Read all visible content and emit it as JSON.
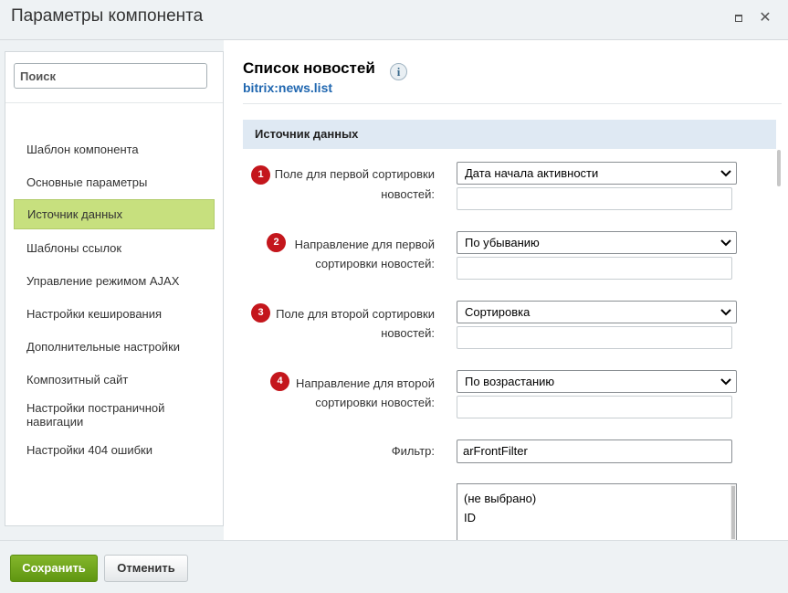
{
  "dialog": {
    "title": "Параметры компонента"
  },
  "sidebar": {
    "search_placeholder": "Поиск",
    "items": [
      {
        "label": "Шаблон компонента"
      },
      {
        "label": "Основные параметры"
      },
      {
        "label": "Источник данных",
        "active": true
      },
      {
        "label": "Шаблоны ссылок"
      },
      {
        "label": "Управление режимом AJAX"
      },
      {
        "label": "Настройки кеширования"
      },
      {
        "label": "Дополнительные настройки"
      },
      {
        "label": "Композитный сайт"
      },
      {
        "label": "Настройки постраничной навигации"
      },
      {
        "label": "Настройки 404 ошибки"
      }
    ]
  },
  "component": {
    "title": "Список новостей",
    "info_icon_glyph": "i",
    "code": "bitrix:news.list"
  },
  "section": {
    "title": "Источник данных"
  },
  "fields": [
    {
      "badge": "1",
      "label_line1": "Поле для первой сортировки",
      "label_line2": "новостей:",
      "value": "Дата начала активности",
      "extra_value": ""
    },
    {
      "badge": "2",
      "label_line1": "Направление для первой",
      "label_line2": "сортировки новостей:",
      "value": "По убыванию",
      "extra_value": ""
    },
    {
      "badge": "3",
      "label_line1": "Поле для второй сортировки",
      "label_line2": "новостей:",
      "value": "Сортировка",
      "extra_value": ""
    },
    {
      "badge": "4",
      "label_line1": "Направление для второй",
      "label_line2": "сортировки новостей:",
      "value": "По возрастанию",
      "extra_value": ""
    }
  ],
  "filter": {
    "label": "Фильтр:",
    "value": "arFrontFilter"
  },
  "listbox": {
    "options": [
      "(не выбрано)",
      "ID"
    ]
  },
  "footer": {
    "save_label": "Сохранить",
    "cancel_label": "Отменить"
  },
  "colors": {
    "active_nav_bg": "#c7e07e",
    "badge_red": "#c4161c",
    "save_green": "#6ea31d",
    "link_blue": "#2067b0",
    "section_header_bg": "#dfe9f3"
  }
}
